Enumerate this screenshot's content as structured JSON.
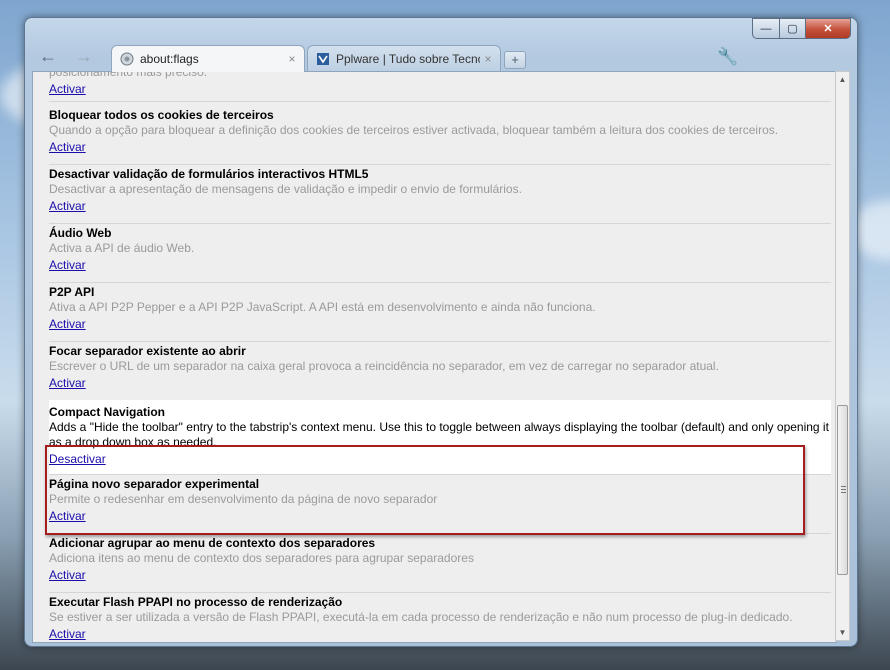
{
  "tabs": [
    {
      "title": "about:flags",
      "close": "×"
    },
    {
      "title": "Pplware | Tudo sobre Tecnologia",
      "close": "×"
    }
  ],
  "new_tab_label": "+",
  "window_controls": {
    "minimize": "—",
    "maximize": "▢",
    "close": "✕"
  },
  "partial_top": {
    "desc": "posicionamento mais preciso.",
    "link": "Activar"
  },
  "experiments": [
    {
      "name": "Bloquear todos os cookies de terceiros",
      "desc": "Quando a opção para bloquear a definição dos cookies de terceiros estiver activada, bloquear também a leitura dos cookies de terceiros.",
      "link": "Activar"
    },
    {
      "name": "Desactivar validação de formulários interactivos HTML5",
      "desc": "Desactivar a apresentação de mensagens de validação e impedir o envio de formulários.",
      "link": "Activar"
    },
    {
      "name": "Áudio Web",
      "desc": "Activa a API de áudio Web.",
      "link": "Activar"
    },
    {
      "name": "P2P API",
      "desc": "Ativa a API P2P Pepper e a API P2P JavaScript. A API está em desenvolvimento e ainda não funciona.",
      "link": "Activar"
    },
    {
      "name": "Focar separador existente ao abrir",
      "desc": "Escrever o URL de um separador na caixa geral provoca a reincidência no separador, em vez de carregar no separador atual.",
      "link": "Activar"
    },
    {
      "name": "Compact Navigation",
      "desc": "Adds a \"Hide the toolbar\" entry to the tabstrip's context menu. Use this to toggle between always displaying the toolbar (default) and only opening it as a drop down box as needed.",
      "link": "Desactivar",
      "enabled": true
    },
    {
      "name": "Página novo separador experimental",
      "desc": "Permite o redesenhar em desenvolvimento da página de novo separador",
      "link": "Activar"
    },
    {
      "name": "Adicionar agrupar ao menu de contexto dos separadores",
      "desc": "Adiciona itens ao menu de contexto dos separadores para agrupar separadores",
      "link": "Activar"
    },
    {
      "name": "Executar Flash PPAPI no processo de renderização",
      "desc": "Se estiver a ser utilizada a versão de Flash PPAPI, executá-la em cada processo de renderização e não num processo de plug-in dedicado.",
      "link": "Activar"
    }
  ],
  "colors": {
    "highlight_border": "#a41e1e",
    "link": "#1a0dab",
    "desc_gray": "#9a9a9a"
  },
  "icons": {
    "back": "back-arrow-icon",
    "forward": "forward-arrow-icon",
    "wrench": "wrench-icon"
  }
}
